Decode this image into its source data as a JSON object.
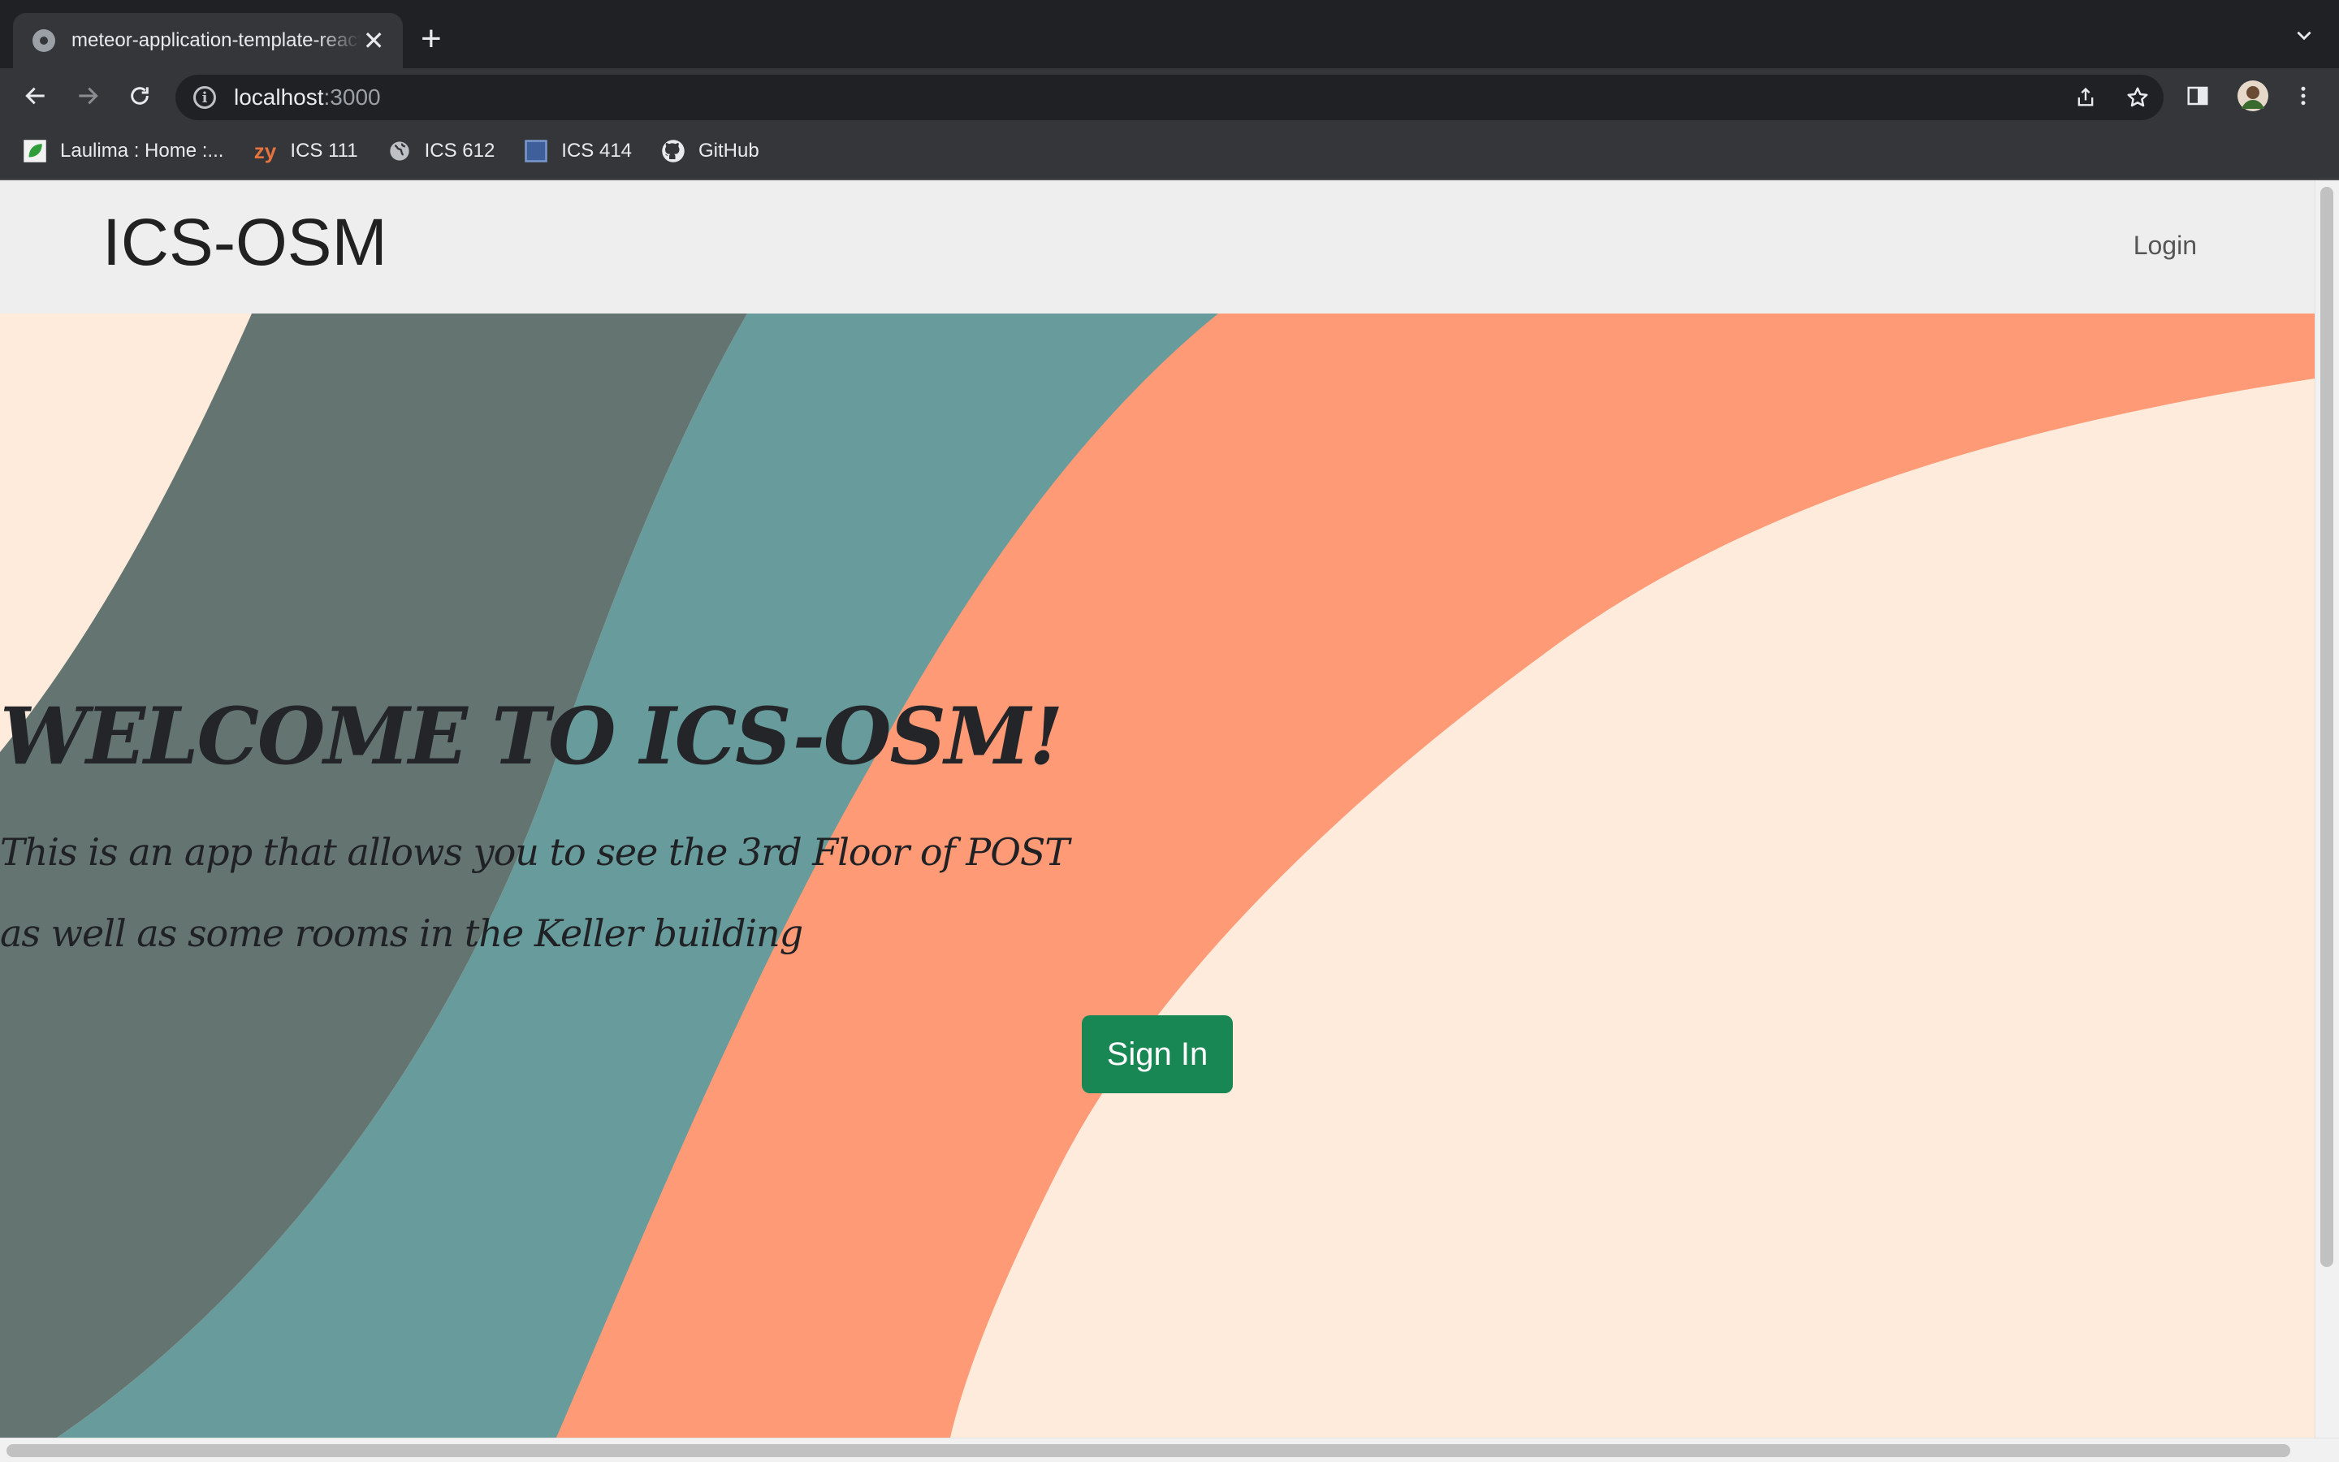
{
  "browser": {
    "tab_title": "meteor-application-template-react",
    "tab_close": "✕",
    "new_tab": "+",
    "url_host": "localhost",
    "url_port": ":3000",
    "info_glyph": "i",
    "bookmarks": [
      {
        "label": "Laulima : Home :...",
        "icon": "leaf-icon"
      },
      {
        "label": "ICS 111",
        "icon": "zybooks-icon"
      },
      {
        "label": "ICS 612",
        "icon": "globe-icon"
      },
      {
        "label": "ICS 414",
        "icon": "square-icon"
      },
      {
        "label": "GitHub",
        "icon": "github-icon"
      }
    ],
    "zybooks_glyph": "zy"
  },
  "page": {
    "brand": "ICS-OSM",
    "nav_login": "Login",
    "hero": {
      "title": "WELCOME TO ICS-OSM!",
      "line1": "This is an app that allows you to see the 3rd Floor of POST",
      "line2": "as well as some rooms in the Keller building",
      "button": "Sign In"
    },
    "colors": {
      "background": "#ffebdc",
      "dark_band": "#647571",
      "teal_band": "#689b9b",
      "salmon_band": "#ff9a76",
      "button": "#198754"
    }
  }
}
